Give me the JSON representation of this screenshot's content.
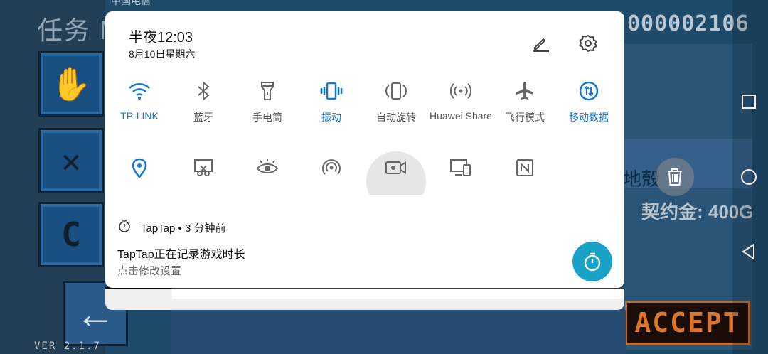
{
  "status_bar": {
    "carrier": "中国电信"
  },
  "game": {
    "title": "任务 M",
    "score": "000002106",
    "shell_label": "地殻",
    "contract": "契约金: 400G",
    "accept_label": "ACCEPT",
    "version": "VER 2.1.7",
    "tiles": [
      {
        "icon": "hand-icon",
        "glyph": "✋"
      },
      {
        "icon": "hammer-icon",
        "glyph": "✕"
      },
      {
        "icon": "c-icon",
        "glyph": "C"
      }
    ],
    "back_glyph": "←"
  },
  "shade": {
    "time": "半夜12:03",
    "date": "8月10日星期六",
    "edit_icon": "edit-icon",
    "settings_icon": "gear-icon",
    "row1": [
      {
        "label": "TP-LINK",
        "icon": "wifi-icon",
        "on": true
      },
      {
        "label": "蓝牙",
        "icon": "bluetooth-icon",
        "on": false
      },
      {
        "label": "手电筒",
        "icon": "flashlight-icon",
        "on": false
      },
      {
        "label": "振动",
        "icon": "vibrate-icon",
        "on": true
      },
      {
        "label": "自动旋转",
        "icon": "rotate-icon",
        "on": false
      },
      {
        "label": "Huawei Share",
        "icon": "huawei-share-icon",
        "on": false
      },
      {
        "label": "飞行模式",
        "icon": "airplane-icon",
        "on": false
      },
      {
        "label": "移动数据",
        "icon": "mobile-data-icon",
        "on": true
      }
    ],
    "row2": [
      {
        "icon": "location-icon",
        "on": true
      },
      {
        "icon": "screenshot-icon",
        "on": false
      },
      {
        "icon": "eye-comfort-icon",
        "on": false
      },
      {
        "icon": "hotspot-icon",
        "on": false
      },
      {
        "icon": "screen-record-icon",
        "on": false
      },
      {
        "icon": "multi-screen-icon",
        "on": false
      },
      {
        "icon": "nfc-icon",
        "on": false
      }
    ]
  },
  "notification": {
    "app_line": "TapTap • 3 分钟前",
    "title": "TapTap正在记录游戏时长",
    "subtitle": "点击修改设置",
    "action_icon": "timer-icon"
  },
  "navbar": {
    "recent_icon": "recent-apps-icon",
    "home_icon": "home-icon",
    "back_icon": "back-icon"
  },
  "colors": {
    "accent": "#1477d6",
    "fab": "#17a2c6",
    "accept": "#d9762f"
  }
}
